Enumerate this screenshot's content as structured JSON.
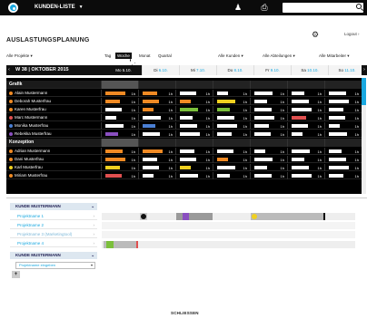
{
  "topbar": {
    "title": "KUNDEN-LISTE",
    "caret": "▼",
    "icons": [
      "user-icon",
      "printer-icon",
      "search-icon"
    ],
    "search_value": ""
  },
  "page": {
    "title": "AUSLASTUNGSPLANUNG",
    "logout": "Logout ›"
  },
  "filters": {
    "projects": "Alle Projekte",
    "customers": "Alle Kunden",
    "departments": "Alle Abteilungen",
    "employees": "Alle Mitarbeiter"
  },
  "views": [
    "Tag",
    "Woche",
    "Monat",
    "Quartal"
  ],
  "active_view": "Woche",
  "week": {
    "label": "W 38 | OKTOBER 2015",
    "prev": "‹",
    "next": "›"
  },
  "days": [
    {
      "name": "Mo",
      "date": "5.10."
    },
    {
      "name": "Di",
      "date": "6.10."
    },
    {
      "name": "Mi",
      "date": "7.10."
    },
    {
      "name": "Do",
      "date": "8.10."
    },
    {
      "name": "Fr",
      "date": "9.10."
    },
    {
      "name": "Sa",
      "date": "10.10."
    },
    {
      "name": "So",
      "date": "11.10."
    }
  ],
  "groups": [
    {
      "name": "Grafik",
      "people": [
        {
          "name": "Alain Mustermann",
          "color": "#f08a24"
        },
        {
          "name": "Deborah Musterfrau",
          "color": "#f08a24"
        },
        {
          "name": "Karen Musterfrau",
          "color": "#f08a24"
        },
        {
          "name": "Marc Mustermann",
          "color": "#e05050"
        },
        {
          "name": "Monika Musterfrau",
          "color": "#4a7fd4"
        },
        {
          "name": "Rebekka Musterfrau",
          "color": "#8a4fc0"
        }
      ]
    },
    {
      "name": "Konzeption",
      "people": [
        {
          "name": "Adrian Mustermann",
          "color": "#f08a24"
        },
        {
          "name": "Dani Musterfrau",
          "color": "#f08a24"
        },
        {
          "name": "Karl Musterfrau",
          "color": "#f0d020"
        },
        {
          "name": "Miriam Musterfrau",
          "color": "#f08a24"
        }
      ]
    }
  ],
  "hours": "1h",
  "customer_panel": {
    "header": "KUNDE MUSTERMANN",
    "projects": [
      "Projektname 1",
      "Projektname 2",
      "Projektname 3 (Marketingtool)",
      "Projektname 4"
    ],
    "header2": "KUNDE MUSTERMANN",
    "select_value": "Projektname eingeben",
    "add": "+"
  },
  "colors": {
    "accent": "#19a8e0",
    "orange": "#f08a24",
    "yellow": "#f0d020",
    "purple": "#8a4fc0",
    "green": "#7bbf3b",
    "red": "#e05050"
  },
  "close_label": "SCHLIESSEN"
}
